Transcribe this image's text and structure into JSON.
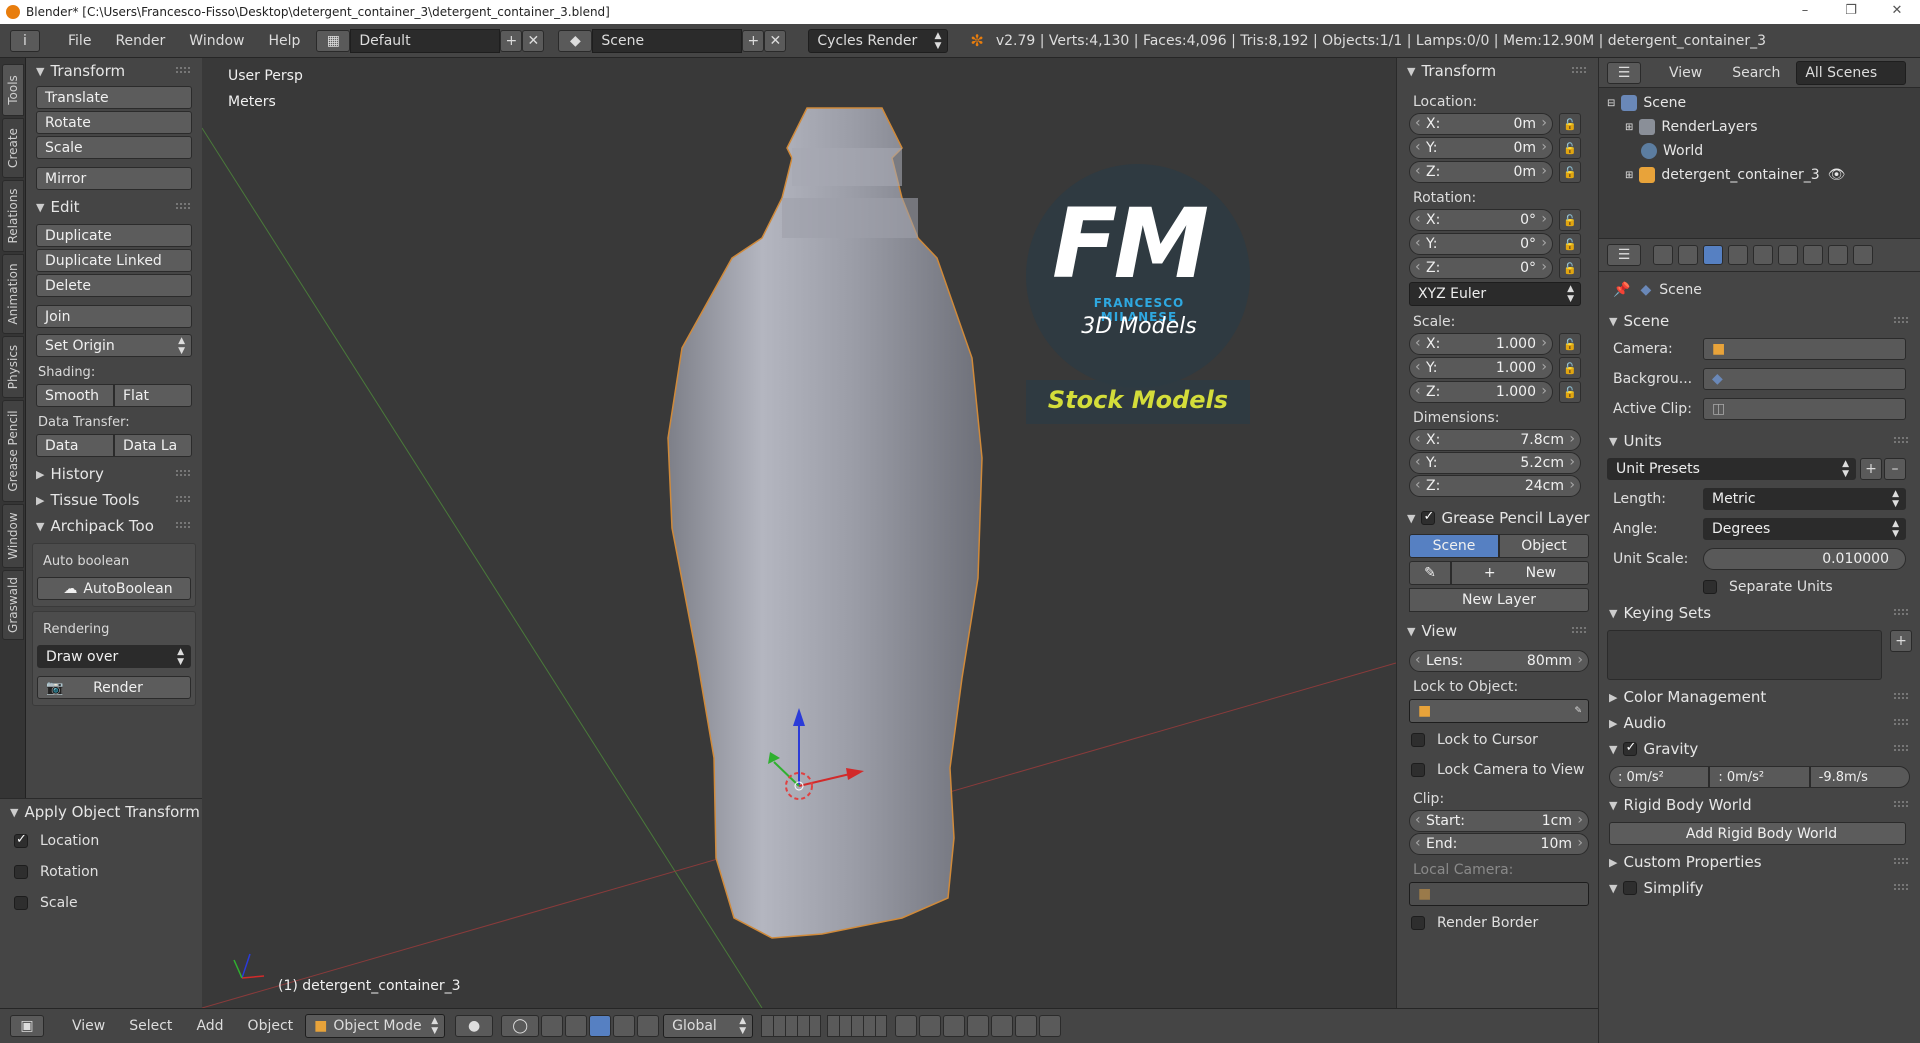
{
  "title_bar": {
    "text": "Blender* [C:\\Users\\Francesco-Fisso\\Desktop\\detergent_container_3\\detergent_container_3.blend]"
  },
  "menus": [
    "File",
    "Render",
    "Window",
    "Help"
  ],
  "layout": "Default",
  "scene": "Scene",
  "engine": "Cycles Render",
  "stats": "v2.79 | Verts:4,130 | Faces:4,096 | Tris:8,192 | Objects:1/1 | Lamps:0/0 | Mem:12.90M | detergent_container_3",
  "vtabs": [
    "Tools",
    "Create",
    "Relations",
    "Animation",
    "Physics",
    "Grease Pencil",
    "Window",
    "Graswald"
  ],
  "tools": {
    "transform_title": "Transform",
    "translate": "Translate",
    "rotate": "Rotate",
    "scale": "Scale",
    "mirror": "Mirror",
    "edit_title": "Edit",
    "duplicate": "Duplicate",
    "duplicate_linked": "Duplicate Linked",
    "delete": "Delete",
    "join": "Join",
    "set_origin": "Set Origin",
    "shading_label": "Shading:",
    "smooth": "Smooth",
    "flat": "Flat",
    "data_transfer_label": "Data Transfer:",
    "data": "Data",
    "data_la": "Data La",
    "history": "History",
    "tissue": "Tissue Tools",
    "archipack": "Archipack Too",
    "auto_boolean_label": "Auto boolean",
    "autoboolean": "AutoBoolean",
    "rendering_label": "Rendering",
    "draw_over": "Draw over",
    "render": "Render"
  },
  "last_op": {
    "title": "Apply Object Transform",
    "location": "Location",
    "rotation": "Rotation",
    "scale": "Scale"
  },
  "viewport": {
    "persp": "User Persp",
    "units": "Meters",
    "object": "(1) detergent_container_3",
    "watermark_letters": "FM",
    "watermark_name": "FRANCESCO MILANESE",
    "watermark_sub": "3D Models",
    "watermark_banner": "Stock Models"
  },
  "npanel": {
    "transform_title": "Transform",
    "location_label": "Location:",
    "loc_x": "X:",
    "loc_x_val": "0m",
    "loc_y": "Y:",
    "loc_y_val": "0m",
    "loc_z": "Z:",
    "loc_z_val": "0m",
    "rotation_label": "Rotation:",
    "rot_x": "X:",
    "rot_x_val": "0°",
    "rot_y": "Y:",
    "rot_y_val": "0°",
    "rot_z": "Z:",
    "rot_z_val": "0°",
    "euler": "XYZ Euler",
    "scale_label": "Scale:",
    "sc_x": "X:",
    "sc_x_val": "1.000",
    "sc_y": "Y:",
    "sc_y_val": "1.000",
    "sc_z": "Z:",
    "sc_z_val": "1.000",
    "dimensions_label": "Dimensions:",
    "dim_x": "X:",
    "dim_x_val": "7.8cm",
    "dim_y": "Y:",
    "dim_y_val": "5.2cm",
    "dim_z": "Z:",
    "dim_z_val": "24cm",
    "gp_title": "Grease Pencil Layer",
    "gp_scene": "Scene",
    "gp_object": "Object",
    "gp_new": "New",
    "gp_new_layer": "New Layer",
    "view_title": "View",
    "lens": "Lens:",
    "lens_val": "80mm",
    "lock_obj": "Lock to Object:",
    "lock_cursor": "Lock to Cursor",
    "lock_cam": "Lock Camera to View",
    "clip_label": "Clip:",
    "clip_start": "Start:",
    "clip_start_val": "1cm",
    "clip_end": "End:",
    "clip_end_val": "10m",
    "local_cam": "Local Camera:",
    "render_border": "Render Border"
  },
  "outliner": {
    "view": "View",
    "search": "Search",
    "all_scenes": "All Scenes",
    "scene": "Scene",
    "render_layers": "RenderLayers",
    "world": "World",
    "object": "detergent_container_3"
  },
  "props": {
    "context": "Scene",
    "scene_title": "Scene",
    "camera": "Camera:",
    "background": "Backgrou...",
    "active_clip": "Active Clip:",
    "units_title": "Units",
    "unit_presets": "Unit Presets",
    "length": "Length:",
    "length_val": "Metric",
    "angle": "Angle:",
    "angle_val": "Degrees",
    "unit_scale": "Unit Scale:",
    "unit_scale_val": "0.010000",
    "separate_units": "Separate Units",
    "keying_sets": "Keying Sets",
    "color_mgmt": "Color Management",
    "audio": "Audio",
    "gravity": "Gravity",
    "grav_x": ": 0m/s²",
    "grav_y": ": 0m/s²",
    "grav_z": "-9.8m/s",
    "rigid_body": "Rigid Body World",
    "add_rigid": "Add Rigid Body World",
    "custom_props": "Custom Properties",
    "simplify": "Simplify"
  },
  "status": {
    "view": "View",
    "select": "Select",
    "add": "Add",
    "object": "Object",
    "mode": "Object Mode",
    "orientation": "Global"
  },
  "colors": {
    "accent": "#5680c2",
    "bg": "#393939",
    "panel": "#454545",
    "orange": "#e87d0d"
  }
}
